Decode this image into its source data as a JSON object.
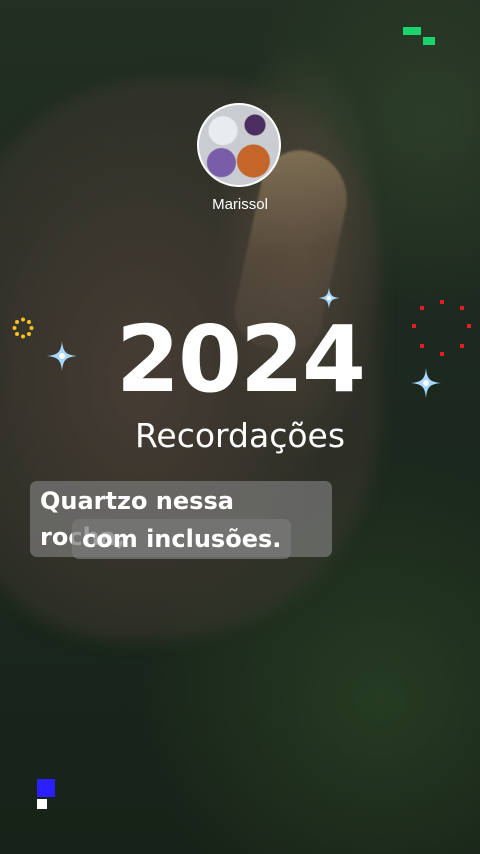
{
  "story": {
    "username": "Marissol",
    "title": "2024",
    "subtitle": "Recordações",
    "caption_line1": "Quartzo nessa rocha,",
    "caption_line2": "com inclusões."
  },
  "colors": {
    "text": "#ffffff",
    "caption_bg": "#787878",
    "accent_green": "#17d46b",
    "accent_blue": "#2a1fff",
    "sparkle_blue": "#a8d8ff",
    "sun_yellow": "#f6c21b",
    "ring_red": "#e02020"
  },
  "icons": [
    "sparkle-icon",
    "sun-icon",
    "red-dot-ring-icon",
    "green-logo-icon"
  ]
}
